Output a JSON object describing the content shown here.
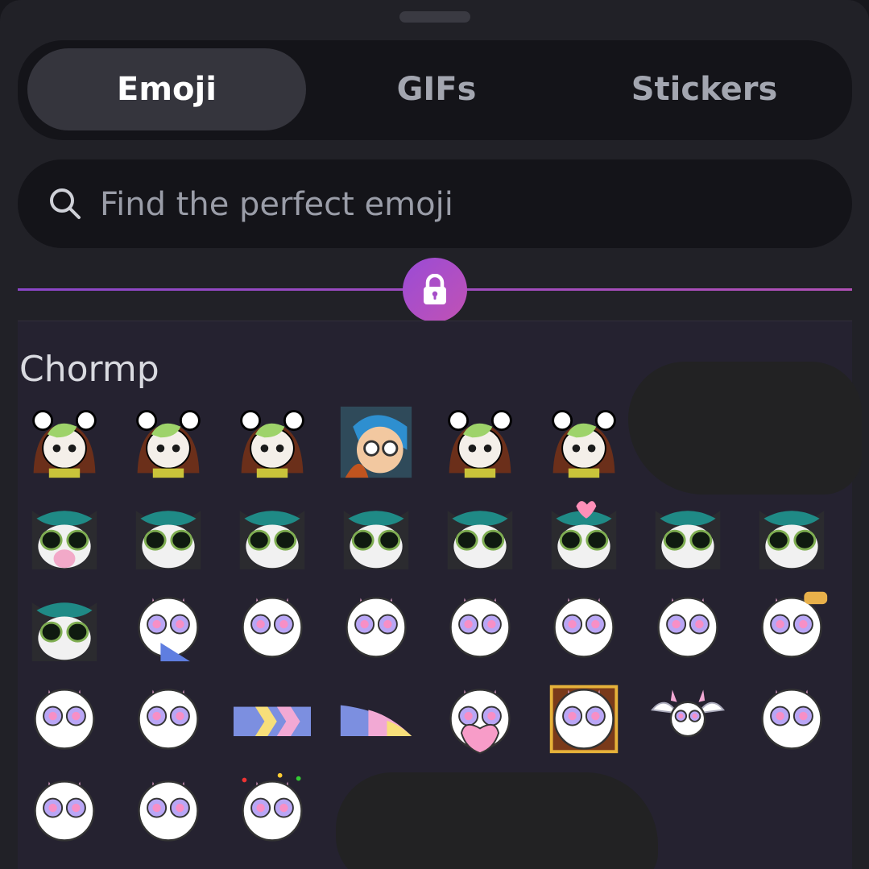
{
  "tabs": [
    {
      "label": "Emoji",
      "active": true
    },
    {
      "label": "GIFs",
      "active": false
    },
    {
      "label": "Stickers",
      "active": false
    }
  ],
  "search": {
    "placeholder": "Find the perfect emoji",
    "value": ""
  },
  "section": {
    "title": "Chormp"
  },
  "emoji_rows": [
    [
      "panda-green-hair",
      "panda-hug",
      "panda-glasses",
      "blue-haired-person",
      "panda-head",
      "panda-typing"
    ],
    [
      "cat-teal-scream",
      "cat-teal-glasses",
      "cat-teal-sleeping",
      "cat-teal-crying",
      "cat-teal-grin",
      "cat-teal-hearts",
      "cat-teal-smug",
      "cat-teal-blush"
    ],
    [
      "cat-teal-stare",
      "creature-tongue",
      "creature-sad",
      "creature-crying",
      "creature-dab",
      "creature-facepalm",
      "creature-dizzy",
      "creature-burger"
    ],
    [
      "creature-heart-eyes",
      "creature-peek",
      "tail-striped",
      "tail-tip",
      "creature-heart-hug",
      "creature-treasure-box",
      "creature-winged",
      "creature-blep"
    ],
    [
      "creature-point",
      "creature-bandage",
      "creature-confetti"
    ]
  ],
  "colors": {
    "accent_start": "#9a4bd6",
    "accent_end": "#c152b4",
    "teal": "#1f8a86",
    "pink": "#f2a9d4",
    "blue": "#7c8fe0"
  }
}
